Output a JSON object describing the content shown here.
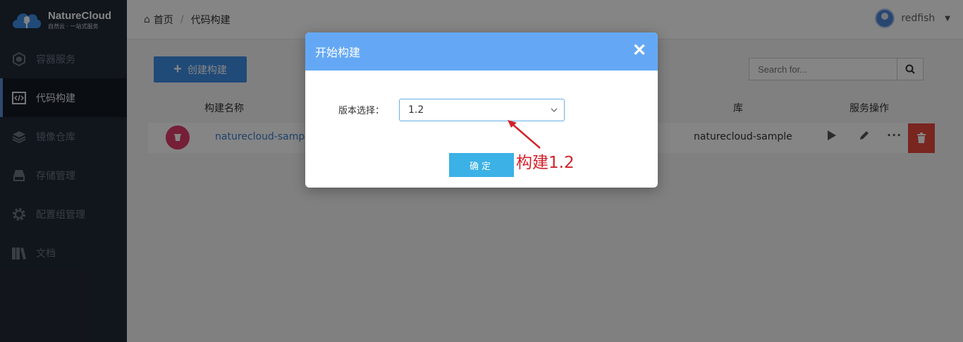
{
  "app": {
    "name": "NatureCloud",
    "tagline": "自然云 · 一站式服务"
  },
  "sidebar": {
    "items": [
      {
        "label": "容器服务",
        "icon": "cube-icon",
        "active": false
      },
      {
        "label": "代码构建",
        "icon": "code-icon",
        "active": true
      },
      {
        "label": "镜像仓库",
        "icon": "layers-icon",
        "active": false
      },
      {
        "label": "存储管理",
        "icon": "drive-icon",
        "active": false
      },
      {
        "label": "配置组管理",
        "icon": "gear-icon",
        "active": false
      },
      {
        "label": "文档",
        "icon": "books-icon",
        "active": false
      }
    ]
  },
  "header": {
    "breadcrumb_home": "首页",
    "breadcrumb_current": "代码构建",
    "username": "redfish"
  },
  "toolbar": {
    "create_label": "创建构建",
    "search_placeholder": "Search for..."
  },
  "table": {
    "headers": {
      "name": "构建名称",
      "repo": "库",
      "ops": "服务操作"
    },
    "rows": [
      {
        "name": "naturecloud-sample",
        "repo": "naturecloud-sample"
      }
    ]
  },
  "modal": {
    "title": "开始构建",
    "field_label": "版本选择：",
    "selected_version": "1.2",
    "confirm_label": "确定"
  },
  "annotation": {
    "text": "构建1.2",
    "color": "#d2222a"
  },
  "colors": {
    "sidebar_bg": "#222a36",
    "accent": "#3e8fe6",
    "modal_header": "#64a8f5",
    "confirm": "#3bb1e6",
    "danger": "#e8473f"
  }
}
